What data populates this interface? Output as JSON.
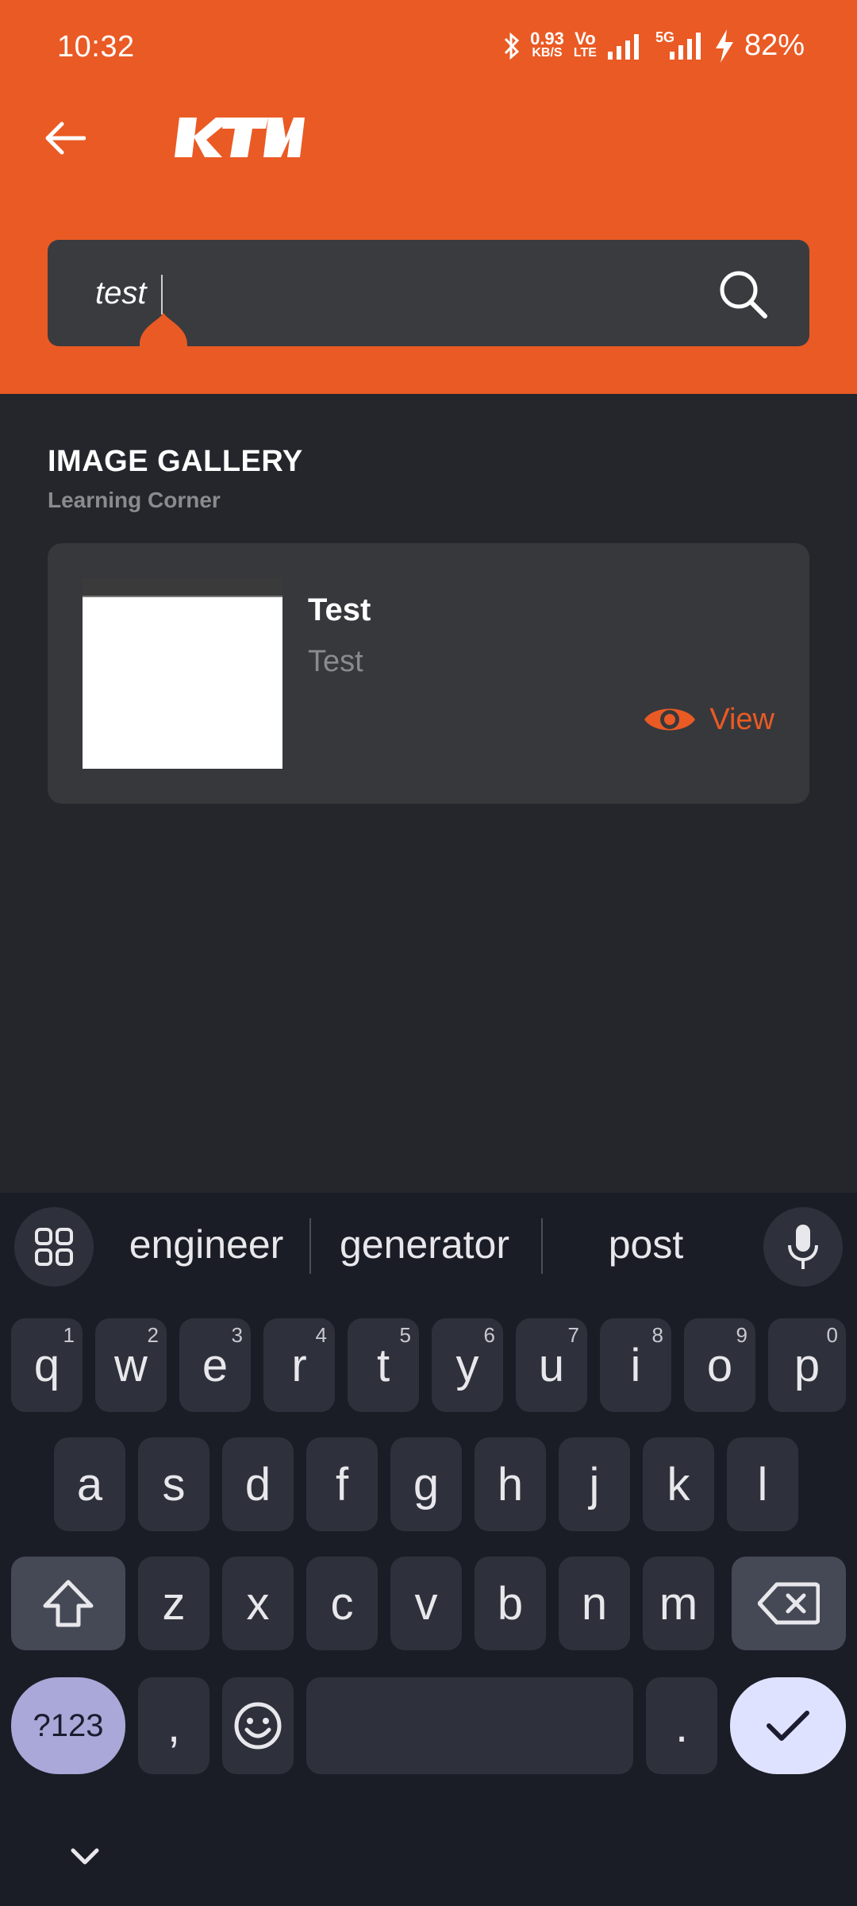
{
  "status_bar": {
    "time": "10:32",
    "net_speed_value": "0.93",
    "net_speed_unit": "KB/S",
    "volte_top": "Vo",
    "volte_bottom": "LTE",
    "fiveg_label": "5G",
    "battery": "82%"
  },
  "header": {
    "back_icon": "arrow-left-icon",
    "logo_text": "KTM"
  },
  "search": {
    "value": "test",
    "placeholder": "",
    "search_icon": "search-icon"
  },
  "section": {
    "title": "IMAGE GALLERY",
    "subtitle": "Learning Corner"
  },
  "results": [
    {
      "title": "Test",
      "subtitle": "Test",
      "action_label": "View",
      "action_icon": "eye-icon"
    }
  ],
  "keyboard": {
    "suggestions": [
      "engineer",
      "generator",
      "post"
    ],
    "row1": [
      {
        "k": "q",
        "n": "1"
      },
      {
        "k": "w",
        "n": "2"
      },
      {
        "k": "e",
        "n": "3"
      },
      {
        "k": "r",
        "n": "4"
      },
      {
        "k": "t",
        "n": "5"
      },
      {
        "k": "y",
        "n": "6"
      },
      {
        "k": "u",
        "n": "7"
      },
      {
        "k": "i",
        "n": "8"
      },
      {
        "k": "o",
        "n": "9"
      },
      {
        "k": "p",
        "n": "0"
      }
    ],
    "row2": [
      "a",
      "s",
      "d",
      "f",
      "g",
      "h",
      "j",
      "k",
      "l"
    ],
    "row3": [
      "z",
      "x",
      "c",
      "v",
      "b",
      "n",
      "m"
    ],
    "symbols_label": "?123",
    "comma_label": ",",
    "period_label": "."
  },
  "colors": {
    "brand": "#ea5a24",
    "background": "#24262b",
    "card": "#37383c",
    "keyboard_bg": "#1b1d26"
  }
}
